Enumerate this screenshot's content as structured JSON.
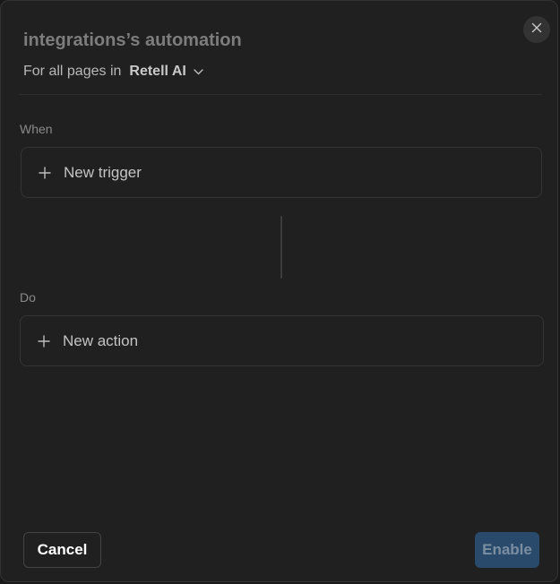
{
  "dialog": {
    "title": "integrations’s automation",
    "scope": {
      "prefix": "For all pages in",
      "selected": "Retell AI"
    }
  },
  "when": {
    "label": "When",
    "add_label": "New trigger"
  },
  "do": {
    "label": "Do",
    "add_label": "New action"
  },
  "footer": {
    "cancel_label": "Cancel",
    "enable_label": "Enable",
    "enable_disabled": true
  },
  "icons": {
    "close": "close-icon",
    "chevron": "chevron-down-icon",
    "plus": "plus-icon"
  },
  "colors": {
    "background": "#202020",
    "enable_button": "#2a4a6b",
    "title_text": "#7d7d7d"
  }
}
